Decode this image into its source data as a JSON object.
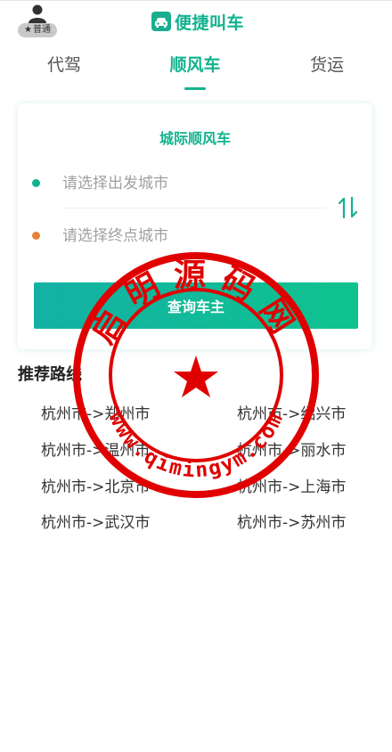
{
  "header": {
    "user_badge": "普通",
    "brand_title": "便捷叫车"
  },
  "tabs": [
    {
      "label": "代驾",
      "active": false
    },
    {
      "label": "顺风车",
      "active": true
    },
    {
      "label": "货运",
      "active": false
    }
  ],
  "card": {
    "title": "城际顺风车",
    "start_placeholder": "请选择出发城市",
    "end_placeholder": "请选择终点城市",
    "query_button": "查询车主"
  },
  "routes": {
    "title": "推荐路线",
    "items": [
      "杭州市->郑州市",
      "杭州市->绍兴市",
      "杭州市->温州市",
      "杭州市->丽水市",
      "杭州市->北京市",
      "杭州市->上海市",
      "杭州市->武汉市",
      "杭州市->苏州市"
    ]
  },
  "watermark": {
    "top_text": "启明源码网",
    "bottom_text": "www.qimingym.com"
  },
  "colors": {
    "accent": "#13b28f",
    "start_dot": "#13b28f",
    "end_dot": "#e8813a",
    "stamp_red": "#e00000"
  }
}
